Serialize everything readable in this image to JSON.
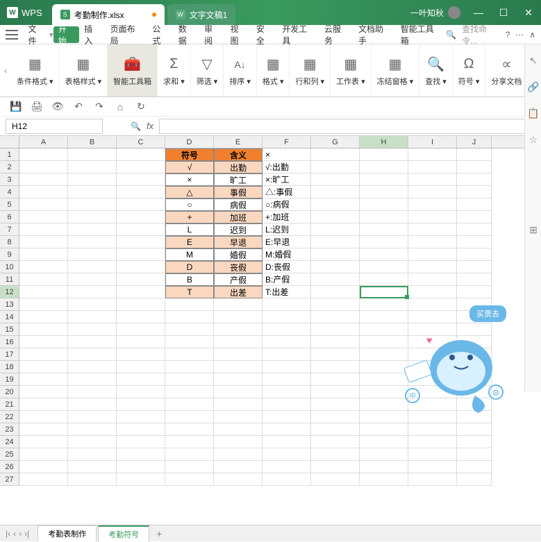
{
  "app": {
    "name": "WPS"
  },
  "tabs": [
    {
      "icon": "S",
      "label": "考勤制作.xlsx",
      "active": true,
      "dirty": true
    },
    {
      "icon": "W",
      "label": "文字文稿1",
      "active": false
    }
  ],
  "user": {
    "name": "一叶知秋"
  },
  "menu": {
    "file": "文件",
    "items": [
      "开始",
      "插入",
      "页面布局",
      "公式",
      "数据",
      "审阅",
      "视图",
      "安全",
      "开发工具",
      "云服务",
      "文档助手",
      "智能工具箱"
    ],
    "active": "开始",
    "search_placeholder": "查找命令..."
  },
  "ribbon": [
    {
      "label": "条件格式",
      "icon": "▦"
    },
    {
      "label": "表格样式",
      "icon": "▦"
    },
    {
      "label": "智能工具箱",
      "icon": "🧰",
      "active": true
    },
    {
      "label": "求和",
      "icon": "Σ"
    },
    {
      "label": "筛选",
      "icon": "▽"
    },
    {
      "label": "排序",
      "icon": "A↓"
    },
    {
      "label": "格式",
      "icon": "▦"
    },
    {
      "label": "行和列",
      "icon": "▦"
    },
    {
      "label": "工作表",
      "icon": "▦"
    },
    {
      "label": "冻结窗格",
      "icon": "▦"
    },
    {
      "label": "查找",
      "icon": "🔍"
    },
    {
      "label": "符号",
      "icon": "Ω"
    },
    {
      "label": "分享文档",
      "icon": "∝"
    }
  ],
  "namebox": "H12",
  "columns": [
    "A",
    "B",
    "C",
    "D",
    "E",
    "F",
    "G",
    "H",
    "I",
    "J"
  ],
  "selected": {
    "col": "H",
    "rowIndex": 12
  },
  "table": {
    "headers": {
      "d": "符号",
      "e": "含义"
    },
    "rows": [
      {
        "d": "√",
        "e": "出勤",
        "f": "√:出勤"
      },
      {
        "d": "×",
        "e": "旷工",
        "f": "×:旷工"
      },
      {
        "d": "△",
        "e": "事假",
        "f": "△:事假"
      },
      {
        "d": "○",
        "e": "病假",
        "f": "○:病假"
      },
      {
        "d": "+",
        "e": "加班",
        "f": "+:加班"
      },
      {
        "d": "L",
        "e": "迟到",
        "f": "L:迟到"
      },
      {
        "d": "E",
        "e": "早退",
        "f": "E:早退"
      },
      {
        "d": "M",
        "e": "婚假",
        "f": "M:婚假"
      },
      {
        "d": "D",
        "e": "丧假",
        "f": "D:丧假"
      },
      {
        "d": "B",
        "e": "产假",
        "f": "B:产假"
      },
      {
        "d": "T",
        "e": "出差",
        "f": "T:出差"
      }
    ],
    "f1": "×"
  },
  "mascot": {
    "bubble": "买票去"
  },
  "sheets": [
    {
      "name": "考勤表制作",
      "active": false
    },
    {
      "name": "考勤符号",
      "active": true
    }
  ]
}
